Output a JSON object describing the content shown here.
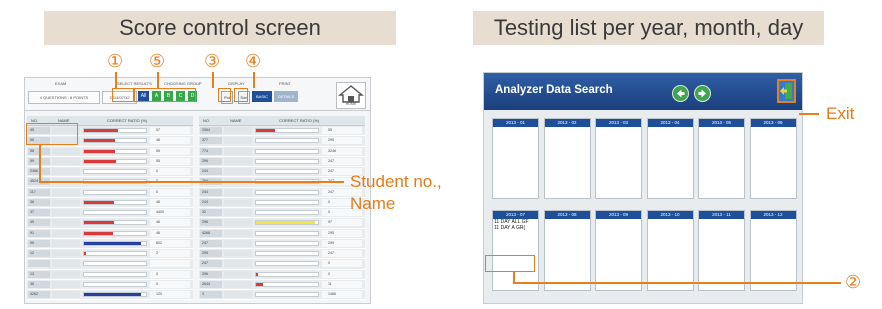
{
  "headers": {
    "left": "Score control screen",
    "right": "Testing list per year, month, day"
  },
  "score_screen": {
    "topbar": {
      "exam_label": "EXAM",
      "exam_value": "4 QUESTIONS : 8 POINTS",
      "select_results_label": "SELECT RESULTS",
      "select_results_value": "2014/07/12",
      "choosing_group_label": "CHOOSING GROUP",
      "groups": [
        "All",
        "A",
        "B",
        "C",
        "D"
      ],
      "display_label": "DISPLAY",
      "display_buttons": [
        "Pct",
        "Sort"
      ],
      "print_label": "PRINT",
      "print_buttons": [
        "BASIC",
        "DETAILS"
      ],
      "home_label": "HOME"
    },
    "columns": [
      "NO.",
      "NAME",
      "CORRECT RATIO (%)"
    ],
    "left_rows": [
      {
        "no": "45",
        "value": "57",
        "fill": 0.55,
        "color": "#d93a3a"
      },
      {
        "no": "56",
        "value": "46",
        "fill": 0.5,
        "color": "#d93a3a"
      },
      {
        "no": "58",
        "value": "55",
        "fill": 0.5,
        "color": "#d93a3a"
      },
      {
        "no": "59",
        "value": "55",
        "fill": 0.52,
        "color": "#d93a3a"
      },
      {
        "no": "2466",
        "value": "0",
        "fill": 0,
        "color": "#d93a3a"
      },
      {
        "no": "4524",
        "value": "0",
        "fill": 0,
        "color": "#d93a3a"
      },
      {
        "no": "117",
        "value": "0",
        "fill": 0,
        "color": "#d93a3a"
      },
      {
        "no": "36",
        "value": "46",
        "fill": 0.48,
        "color": "#d93a3a"
      },
      {
        "no": "37",
        "value": "4400",
        "fill": 0,
        "color": "#d93a3a"
      },
      {
        "no": "49",
        "value": "46",
        "fill": 0.48,
        "color": "#d93a3a"
      },
      {
        "no": "91",
        "value": "46",
        "fill": 0.47,
        "color": "#d93a3a"
      },
      {
        "no": "99",
        "value": "802",
        "fill": 0.92,
        "color": "#2540a0"
      },
      {
        "no": "12",
        "value": "2",
        "fill": 0.03,
        "color": "#d93a3a"
      },
      {
        "no": "",
        "value": "",
        "fill": 0,
        "color": "#d93a3a"
      },
      {
        "no": "13",
        "value": "0",
        "fill": 0,
        "color": "#d93a3a"
      },
      {
        "no": "36",
        "value": "0",
        "fill": 0,
        "color": "#d93a3a"
      },
      {
        "no": "4262",
        "value": "120",
        "fill": 0.92,
        "color": "#2540a0"
      }
    ],
    "right_rows": [
      {
        "no": "2564",
        "value": "55",
        "fill": 0.3,
        "color": "#d93a3a"
      },
      {
        "no": "377",
        "value": "295",
        "fill": 0,
        "color": "#d93a3a"
      },
      {
        "no": "774",
        "value": "3246",
        "fill": 0,
        "color": "#d93a3a"
      },
      {
        "no": "296",
        "value": "247",
        "fill": 0,
        "color": "#d93a3a"
      },
      {
        "no": "244",
        "value": "247",
        "fill": 0,
        "color": "#d93a3a"
      },
      {
        "no": "294",
        "value": "247",
        "fill": 0,
        "color": "#d93a3a"
      },
      {
        "no": "244",
        "value": "247",
        "fill": 0,
        "color": "#d93a3a"
      },
      {
        "no": "244",
        "value": "0",
        "fill": 0,
        "color": "#d93a3a"
      },
      {
        "no": "32",
        "value": "0",
        "fill": 0,
        "color": "#d93a3a"
      },
      {
        "no": "296",
        "value": "97",
        "fill": 0.95,
        "color": "#f2e44a"
      },
      {
        "no": "4268",
        "value": "295",
        "fill": 0,
        "color": "#d93a3a"
      },
      {
        "no": "247",
        "value": "299",
        "fill": 0,
        "color": "#d93a3a"
      },
      {
        "no": "295",
        "value": "247",
        "fill": 0,
        "color": "#d93a3a"
      },
      {
        "no": "247",
        "value": "0",
        "fill": 0,
        "color": "#d93a3a"
      },
      {
        "no": "296",
        "value": "0",
        "fill": 0.04,
        "color": "#d93a3a"
      },
      {
        "no": "2644",
        "value": "11",
        "fill": 0.12,
        "color": "#d93a3a"
      },
      {
        "no": "3",
        "value": "1466",
        "fill": 0,
        "color": "#d93a3a"
      }
    ]
  },
  "markers": {
    "m1": "①",
    "m2": "②",
    "m3": "③",
    "m4": "④",
    "m5": "⑤"
  },
  "callouts": {
    "student": "Student no.,\nName",
    "exit": "Exit"
  },
  "search_screen": {
    "title": "Analyzer Data Search",
    "months": [
      "2013 - 01",
      "2013 - 02",
      "2013 - 03",
      "2013 - 04",
      "2013 - 05",
      "2013 - 06",
      "2013 - 07",
      "2013 - 08",
      "2013 - 09",
      "2013 - 10",
      "2013 - 11",
      "2013 - 12"
    ],
    "entries": [
      "11 DAY   ALL GF",
      "11 DAY   A   GR("
    ]
  },
  "colors": {
    "accent": "#e87e1c",
    "header_bg": "#e7ddd0",
    "titlebar": "#1f4f99",
    "bar_red": "#d93a3a",
    "bar_blue": "#2540a0",
    "group_green": "#36a84a"
  }
}
